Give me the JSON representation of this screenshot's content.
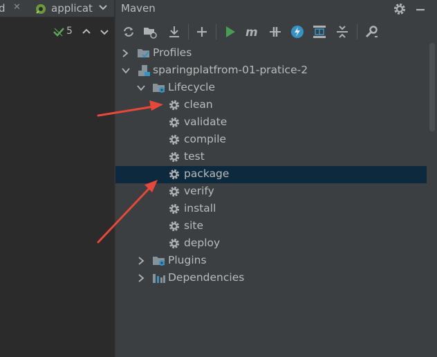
{
  "editor": {
    "tabs": [
      {
        "label": "d"
      },
      {
        "label": "applicat"
      }
    ],
    "inspection_count": "5"
  },
  "maven": {
    "title": "Maven",
    "toolbar": [
      {
        "icon": "reload-icon"
      },
      {
        "icon": "add-folder-icon"
      },
      {
        "icon": "download-icon"
      },
      {
        "icon": "plus-icon"
      },
      {
        "icon": "run-icon"
      },
      {
        "icon": "maven-m-icon"
      },
      {
        "icon": "toggle-offline-icon"
      },
      {
        "icon": "skip-tests-icon"
      },
      {
        "icon": "show-dependencies-icon"
      },
      {
        "icon": "collapse-all-icon"
      },
      {
        "icon": "settings-wrench-icon"
      }
    ],
    "tree": {
      "profiles": "Profiles",
      "project": "sparingplatfrom-01-pratice-2",
      "lifecycle": "Lifecycle",
      "goals": [
        "clean",
        "validate",
        "compile",
        "test",
        "package",
        "verify",
        "install",
        "site",
        "deploy"
      ],
      "selected_goal": "package",
      "plugins": "Plugins",
      "dependencies": "Dependencies"
    },
    "colors": {
      "panel_bg": "#3c3f41",
      "selection_bg": "#0d293e",
      "annotation_arrow": "#e8473a",
      "run_green": "#499c54",
      "accent_blue": "#3592c4"
    }
  }
}
